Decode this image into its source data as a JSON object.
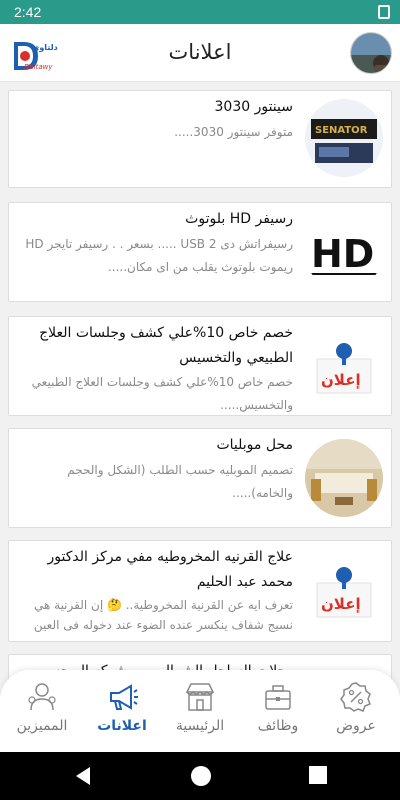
{
  "status_bar": {
    "time": "2:42"
  },
  "app_bar": {
    "title": "اعلانات",
    "logo_text_top": "دلتاوي",
    "logo_text_bottom": "Deltawy"
  },
  "ads": [
    {
      "title": "سينتور 3030",
      "description": "متوفر سينتور 3030.....",
      "image": "receiver-box-image",
      "brand_text": "SENATOR"
    },
    {
      "title": "رسيفر HD بلوتوث",
      "description": "رسيفراتش دى USB 2 ..... بسعر . . رسيفر تايجر HD ريموت بلوتوث يقلب من اى مكان.....",
      "image": "hd-logo-image",
      "brand_text": "HD"
    },
    {
      "title": "خصم خاص 10%علي كشف وجلسات العلاج الطبيعي والتخسيس",
      "description": "خصم خاص 10%علي كشف وجلسات العلاج الطبيعي والتخسيس.....",
      "image": "announcement-pin-image",
      "brand_text": "إعلان"
    },
    {
      "title": "محل موبليات",
      "description": "تصميم الموبليه حسب الطلب (الشكل والحجم والخامه).....",
      "image": "furniture-room-image",
      "brand_text": ""
    },
    {
      "title": "علاج القرنيه المخروطيه مفي مركز الدكتور محمد عبد الحليم",
      "description": "تعرف ايه عن القرنية المخروطية.. 🤔 إن القرنية هي نسيج شفاف ينكسر عنده الضوء عند دخوله فى العين",
      "image": "announcement-pin-image",
      "brand_text": "إعلان"
    },
    {
      "title": "رحلات الساحل الشمالي من شركه البهجه",
      "description": "",
      "image": "announcement-pin-image",
      "brand_text": ""
    }
  ],
  "bottom_nav": {
    "items": [
      {
        "label": "المميزين",
        "icon": "users-icon",
        "active": false
      },
      {
        "label": "اعلانات",
        "icon": "megaphone-icon",
        "active": true
      },
      {
        "label": "الرئيسية",
        "icon": "store-icon",
        "active": false
      },
      {
        "label": "وظائف",
        "icon": "briefcase-icon",
        "active": false
      },
      {
        "label": "عروض",
        "icon": "percent-badge-icon",
        "active": false
      }
    ]
  },
  "colors": {
    "status_bar": "#2a9a8a",
    "active_nav": "#1f5fb0",
    "inactive_nav": "#777777"
  }
}
